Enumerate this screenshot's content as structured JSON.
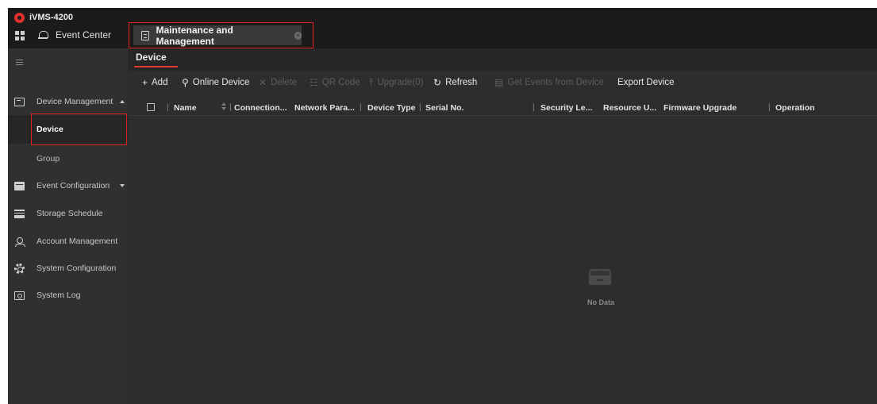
{
  "app": {
    "title": "iVMS-4200"
  },
  "topbar": {
    "event_center_label": "Event Center",
    "active_tab_label": "Maintenance and Management",
    "close_glyph": "×"
  },
  "sidebar": {
    "items": [
      {
        "label": "Device Management",
        "icon": "device-management-icon",
        "expanded": true
      },
      {
        "label": "Device",
        "active": true
      },
      {
        "label": "Group"
      },
      {
        "label": "Event Configuration",
        "icon": "event-configuration-icon",
        "expanded": false
      },
      {
        "label": "Storage Schedule",
        "icon": "storage-icon"
      },
      {
        "label": "Account Management",
        "icon": "account-icon"
      },
      {
        "label": "System Configuration",
        "icon": "gear-icon"
      },
      {
        "label": "System Log",
        "icon": "log-icon"
      }
    ]
  },
  "main": {
    "subtab_label": "Device",
    "toolbar": {
      "add": "Add",
      "online_device": "Online Device",
      "delete": "Delete",
      "qr_code": "QR Code",
      "upgrade": "Upgrade(0)",
      "refresh": "Refresh",
      "get_events": "Get Events from Device",
      "export_device": "Export Device"
    },
    "columns": [
      "Name",
      "Connection...",
      "Network Para...",
      "Device Type",
      "Serial No.",
      "Security Le...",
      "Resource U...",
      "Firmware Upgrade",
      "Operation"
    ],
    "empty_text": "No Data"
  },
  "colors": {
    "accent": "#e03a32",
    "highlight_box": "#e02020"
  }
}
